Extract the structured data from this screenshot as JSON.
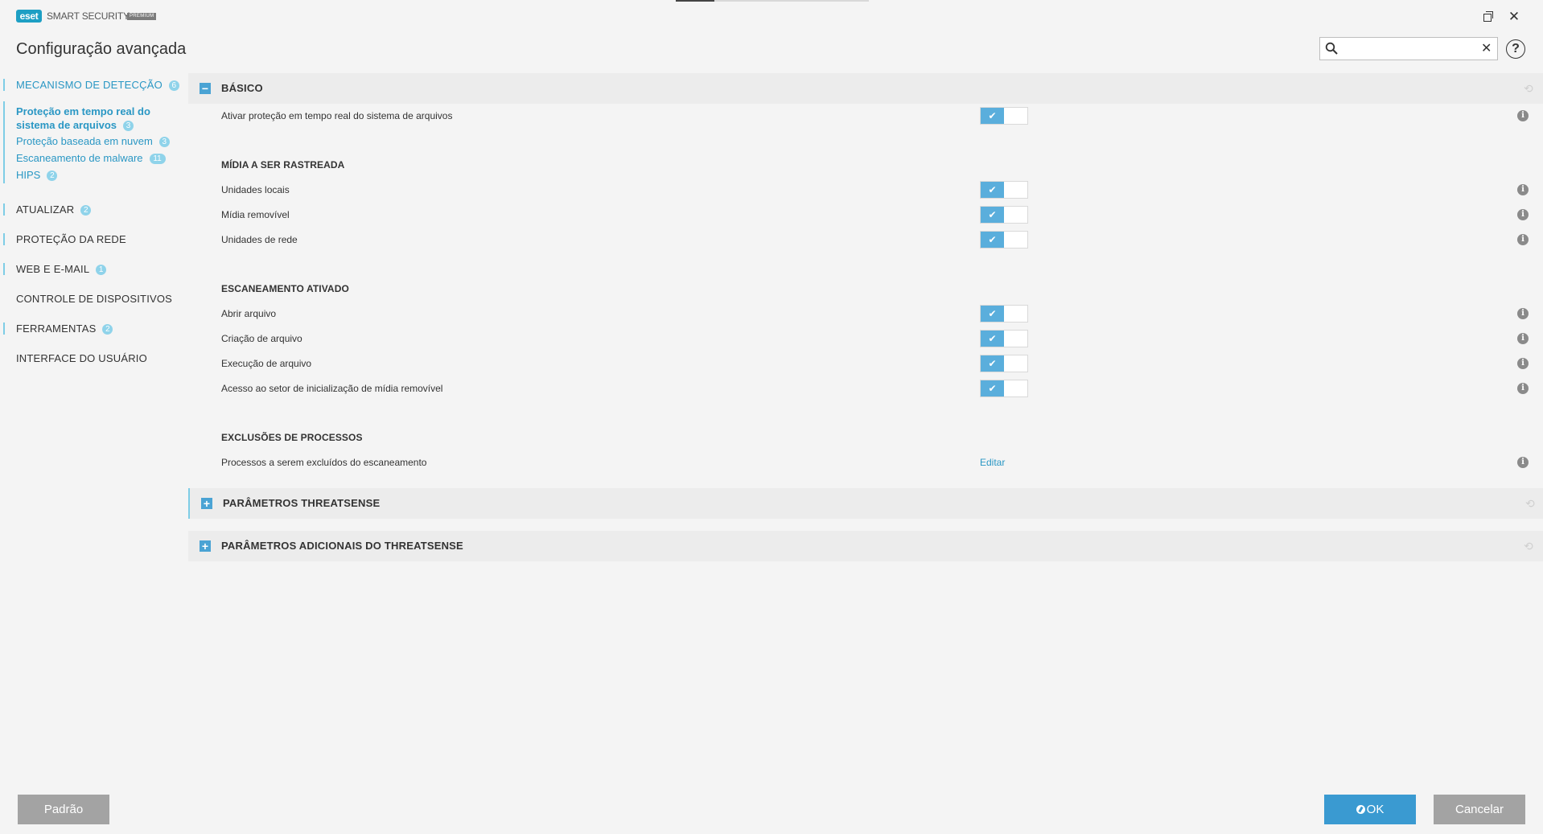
{
  "window": {
    "brand_logo": "eset",
    "product_name": "SMART SECURITY",
    "edition": "PREMIUM",
    "title": "Configuração avançada"
  },
  "search": {
    "value": "",
    "placeholder": ""
  },
  "sidebar": {
    "items": [
      {
        "label": "MECANISMO DE DETECÇÃO",
        "badge": "6"
      },
      {
        "label": "ATUALIZAR",
        "badge": "2"
      },
      {
        "label": "PROTEÇÃO DA REDE"
      },
      {
        "label": "WEB E E-MAIL",
        "badge": "1"
      },
      {
        "label": "CONTROLE DE DISPOSITIVOS"
      },
      {
        "label": "FERRAMENTAS",
        "badge": "2"
      },
      {
        "label": "INTERFACE DO USUÁRIO"
      }
    ],
    "subitems": [
      {
        "label_line1": "Proteção em tempo real do",
        "label_line2": "sistema de arquivos",
        "badge": "3"
      },
      {
        "label": "Proteção baseada em nuvem",
        "badge": "3"
      },
      {
        "label": "Escaneamento de malware",
        "badge": "11"
      },
      {
        "label": "HIPS",
        "badge": "2"
      }
    ]
  },
  "sections": {
    "basic": {
      "title": "BÁSICO",
      "expand_symbol": "−",
      "enable_label": "Ativar proteção em tempo real do sistema de arquivos",
      "enable_value": true
    },
    "media": {
      "title": "MÍDIA A SER RASTREADA",
      "rows": [
        {
          "label": "Unidades locais",
          "value": true
        },
        {
          "label": "Mídia removível",
          "value": true
        },
        {
          "label": "Unidades de rede",
          "value": true
        }
      ]
    },
    "scan_on": {
      "title": "ESCANEAMENTO ATIVADO",
      "rows": [
        {
          "label": "Abrir arquivo",
          "value": true
        },
        {
          "label": "Criação de arquivo",
          "value": true
        },
        {
          "label": "Execução de arquivo",
          "value": true
        },
        {
          "label": "Acesso ao setor de inicialização de mídia removível",
          "value": true
        }
      ]
    },
    "exclusions": {
      "title": "EXCLUSÕES DE PROCESSOS",
      "row_label": "Processos a serem excluídos do escaneamento",
      "link": "Editar"
    },
    "threatsense": {
      "title": "PARÂMETROS THREATSENSE",
      "expand_symbol": "+"
    },
    "threatsense_extra": {
      "title": "PARÂMETROS ADICIONAIS DO THREATSENSE",
      "expand_symbol": "+"
    }
  },
  "icons": {
    "check": "✔",
    "info": "i",
    "reset": "⟲",
    "close": "✕",
    "help": "?"
  },
  "buttons": {
    "default": "Padrão",
    "ok": "OK",
    "cancel": "Cancelar"
  },
  "colors": {
    "accent": "#2a97c4",
    "toggle_on": "#5aaedc",
    "ok_button": "#3a9ad1",
    "neutral_button": "#a3a3a3"
  }
}
